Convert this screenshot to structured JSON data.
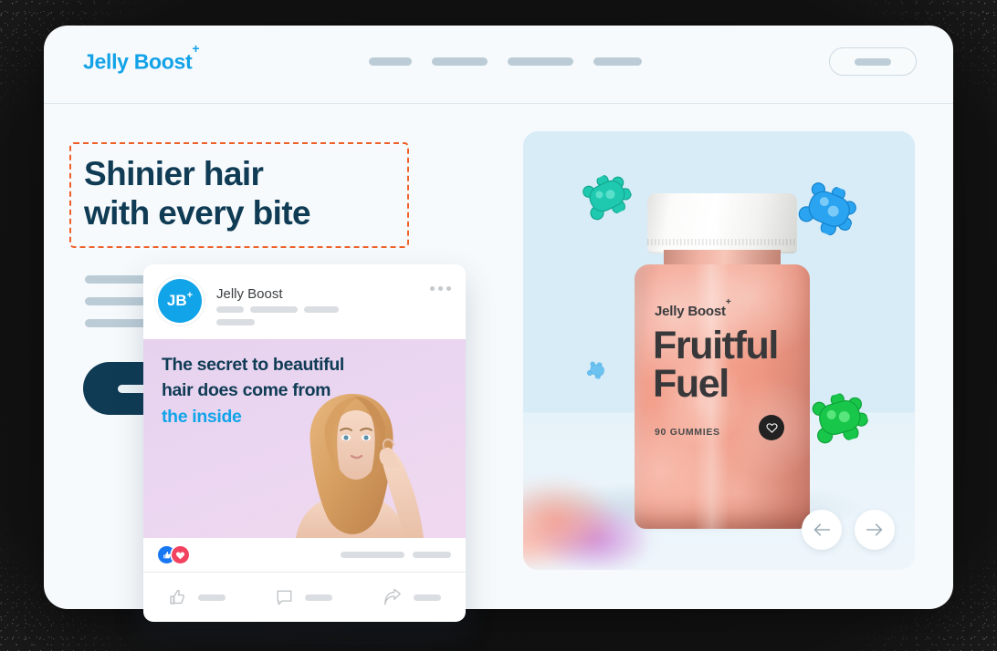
{
  "frame": {
    "background_color": "#3d6048",
    "window_background": "#f7fafc"
  },
  "header": {
    "logo_text": "Jelly Boost",
    "logo_superscript": "+",
    "logo_color": "#11a2e8",
    "nav_placeholders": [
      1,
      2,
      3,
      4
    ],
    "cta_button_label": ""
  },
  "hero": {
    "headline_line1": "Shinier hair",
    "headline_line2": "with every bite",
    "headline_color": "#0f3b54",
    "selection_border_color": "#ef5f28",
    "paragraph_placeholders": [
      1,
      2,
      3
    ],
    "cta_button_label": ""
  },
  "product": {
    "panel_background": "#d7ecf7",
    "bottle": {
      "brand": "Jelly Boost",
      "brand_superscript": "+",
      "product_name_line1": "Fruitful",
      "product_name_line2": "Fuel",
      "count_label": "90 GUMMIES",
      "badge_icon": "heart-icon"
    },
    "gummies": [
      {
        "name": "gummy-bear-teal",
        "color": "#1fc9b0"
      },
      {
        "name": "gummy-bear-blue",
        "color": "#2aa3f0"
      },
      {
        "name": "gummy-bear-green",
        "color": "#18c64a"
      },
      {
        "name": "gummy-bear-mini-blue",
        "color": "#6cc3f2"
      }
    ],
    "carousel": {
      "prev_icon": "arrow-left-icon",
      "next_icon": "arrow-right-icon"
    }
  },
  "social_post": {
    "avatar_initials": "JB",
    "avatar_superscript": "+",
    "avatar_color": "#12a4e8",
    "author_name": "Jelly Boost",
    "menu_icon": "more-options-icon",
    "post_text_line1": "The secret to beautiful",
    "post_text_line2": "hair does come from",
    "post_text_highlight": "the inside",
    "highlight_color": "#12a4e8",
    "reactions": [
      {
        "name": "reaction-like",
        "icon": "thumbs-up-icon",
        "color": "#1877f2"
      },
      {
        "name": "reaction-love",
        "icon": "heart-icon",
        "color": "#f3425f"
      }
    ],
    "actions": [
      {
        "name": "like-action",
        "icon": "thumbs-up-outline-icon"
      },
      {
        "name": "comment-action",
        "icon": "comment-bubble-icon"
      },
      {
        "name": "share-action",
        "icon": "share-arrow-icon"
      }
    ]
  }
}
